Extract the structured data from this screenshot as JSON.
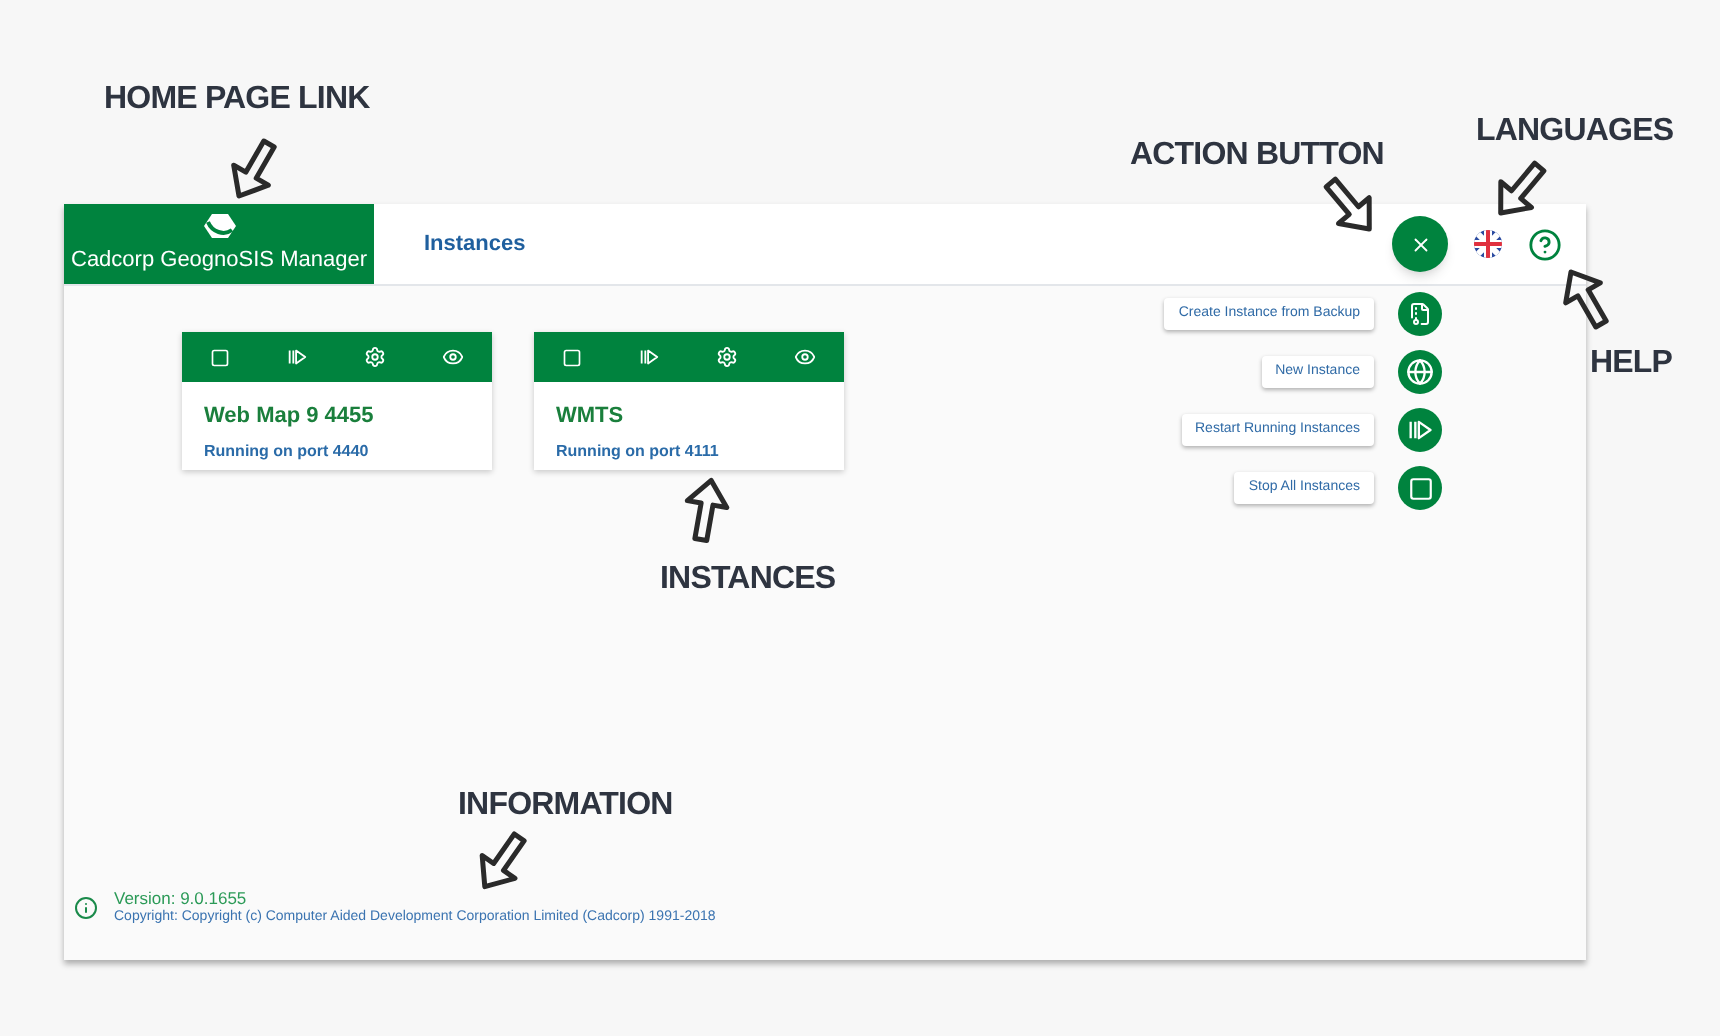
{
  "header": {
    "brand": "Cadcorp GeognoSIS Manager",
    "nav": [
      {
        "label": "Instances",
        "selected": true
      }
    ]
  },
  "instances": [
    {
      "name": "Web Map 9 4455",
      "status": "Running on port 4440"
    },
    {
      "name": "WMTS",
      "status": "Running on port 4111"
    }
  ],
  "speed_dial": {
    "expanded": true,
    "actions": [
      {
        "label": "Create Instance from Backup",
        "kind": "backup"
      },
      {
        "label": "New Instance",
        "kind": "globe"
      },
      {
        "label": "Restart Running Instances",
        "kind": "restart"
      },
      {
        "label": "Stop All Instances",
        "kind": "stop"
      }
    ]
  },
  "footer": {
    "version": "Version: 9.0.1655",
    "copyright": "Copyright: Copyright (c) Computer Aided Development Corporation Limited (Cadcorp) 1991-2018"
  },
  "annotations": [
    "HOME PAGE LINK",
    "ACTION BUTTON",
    "LANGUAGES",
    "HELP",
    "INSTANCES",
    "INFORMATION"
  ]
}
